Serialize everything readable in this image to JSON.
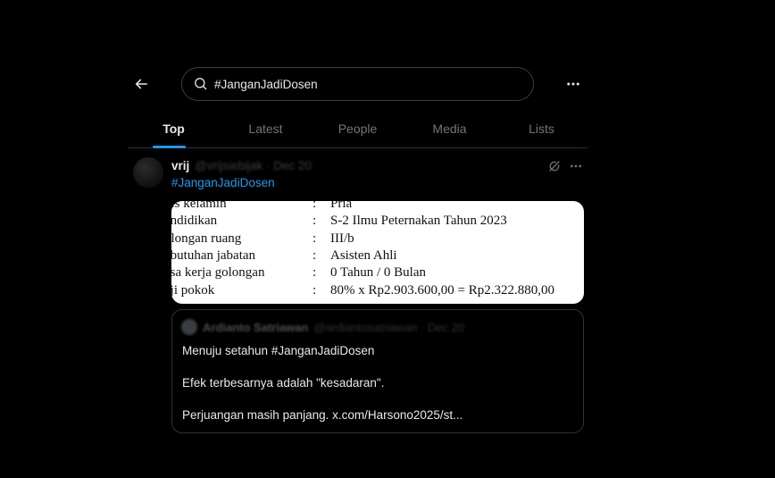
{
  "header": {
    "search_value": "#JanganJadiDosen"
  },
  "tabs": [
    {
      "label": "Top"
    },
    {
      "label": "Latest"
    },
    {
      "label": "People"
    },
    {
      "label": "Media"
    },
    {
      "label": "Lists"
    }
  ],
  "tweet": {
    "author_name": "vrij",
    "author_handle": "@vrijsiebijak · Dec 20",
    "hashtag": "#JanganJadiDosen",
    "media_document": {
      "rows": [
        {
          "label": "nis kelamin",
          "colon": ":",
          "value": "Pria"
        },
        {
          "label": "endidikan",
          "colon": ":",
          "value": "S-2 Ilmu Peternakan Tahun 2023"
        },
        {
          "label": "olongan ruang",
          "colon": ":",
          "value": "III/b"
        },
        {
          "label": "ebutuhan jabatan",
          "colon": ":",
          "value": "Asisten Ahli"
        },
        {
          "label": "asa kerja golongan",
          "colon": ":",
          "value": "0 Tahun / 0 Bulan"
        },
        {
          "label": "aji pokok",
          "colon": ":",
          "value": "80% x Rp2.903.600,00 = Rp2.322.880,00"
        }
      ]
    },
    "quote": {
      "author_name": "Ardianto Satriawan",
      "author_handle": "@ardiantosatriawan · Dec 20",
      "lines": [
        "Menuju setahun #JanganJadiDosen",
        "Efek terbesarnya adalah \"kesadaran\".",
        "Perjuangan masih panjang. x.com/Harsono2025/st..."
      ]
    }
  },
  "colors": {
    "background": "#000000",
    "accent": "#1d9bf0",
    "text_primary": "#e7e9ea",
    "text_secondary": "#71767b",
    "border": "#2f3336"
  },
  "icons": {
    "back": "arrow-left-icon",
    "search": "search-icon",
    "more": "more-horizontal-icon",
    "grok": "grok-icon"
  }
}
